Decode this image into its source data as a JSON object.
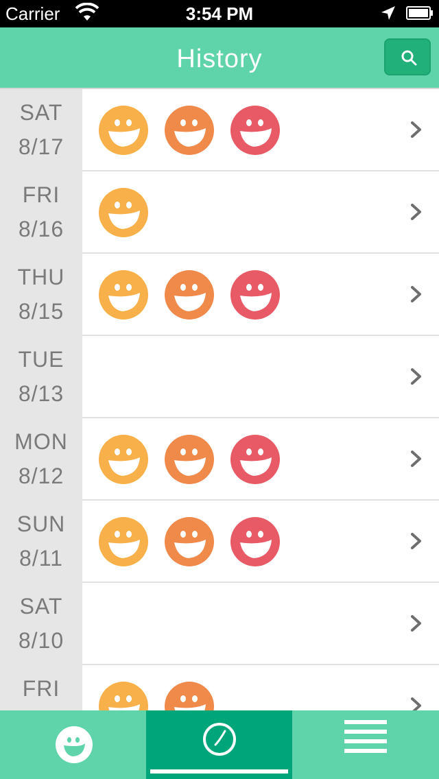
{
  "status_bar": {
    "carrier": "Carrier",
    "time": "3:54 PM"
  },
  "nav": {
    "title": "History",
    "search_icon": "search-icon"
  },
  "colors": {
    "accent": "#5fd3aa",
    "accent_dark": "#00a57a",
    "face_yellow": "#f7b04a",
    "face_orange": "#f08a4b",
    "face_red": "#e85a66"
  },
  "rows": [
    {
      "dow": "SAT",
      "date": "8/17",
      "faces": [
        "yellow",
        "orange",
        "red"
      ]
    },
    {
      "dow": "FRI",
      "date": "8/16",
      "faces": [
        "yellow"
      ]
    },
    {
      "dow": "THU",
      "date": "8/15",
      "faces": [
        "yellow",
        "orange",
        "red"
      ]
    },
    {
      "dow": "TUE",
      "date": "8/13",
      "faces": []
    },
    {
      "dow": "MON",
      "date": "8/12",
      "faces": [
        "yellow",
        "orange",
        "red"
      ]
    },
    {
      "dow": "SUN",
      "date": "8/11",
      "faces": [
        "yellow",
        "orange",
        "red"
      ]
    },
    {
      "dow": "SAT",
      "date": "8/10",
      "faces": []
    },
    {
      "dow": "FRI",
      "date": "",
      "faces": [
        "yellow",
        "orange"
      ]
    }
  ],
  "tabs": [
    {
      "icon": "smiley-icon",
      "active": false
    },
    {
      "icon": "clock-icon",
      "active": true
    },
    {
      "icon": "menu-icon",
      "active": false
    }
  ]
}
